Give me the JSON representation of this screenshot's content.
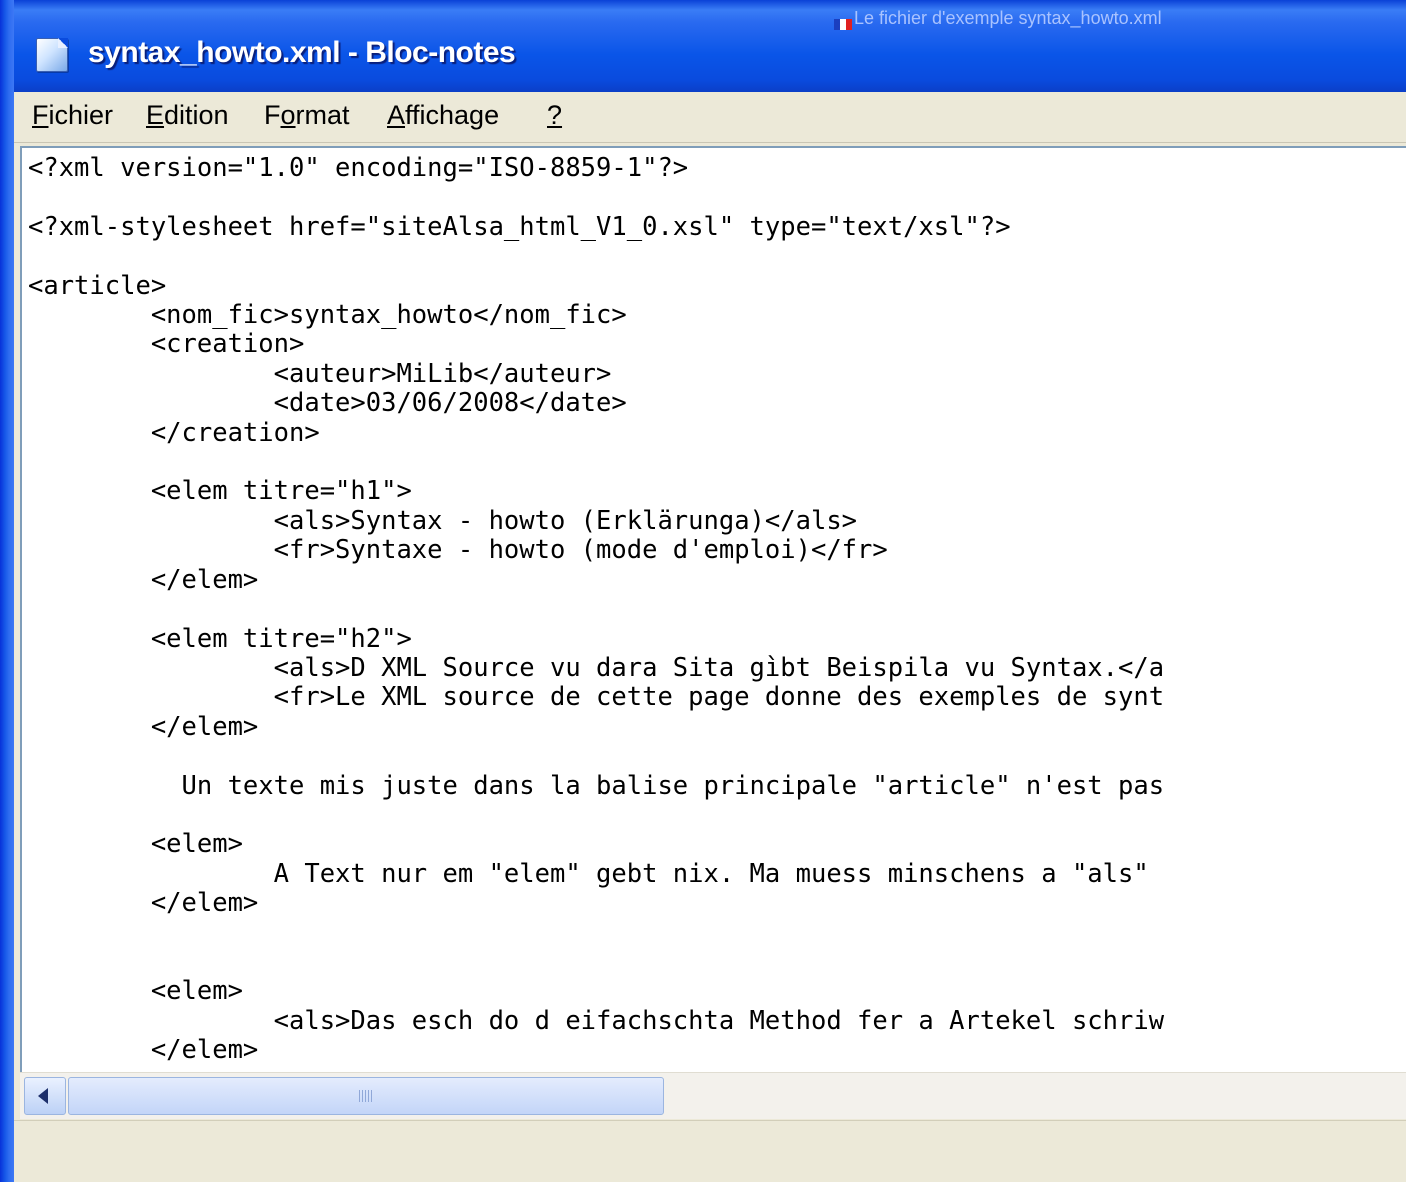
{
  "window": {
    "title": "syntax_howto.xml - Bloc-notes",
    "caption": "Le fichier d'exemple syntax_howto.xml"
  },
  "menu": {
    "file": {
      "pre": "",
      "key": "F",
      "post": "ichier"
    },
    "edit": {
      "pre": "",
      "key": "E",
      "post": "dition"
    },
    "format": {
      "pre": "F",
      "key": "o",
      "post": "rmat"
    },
    "view": {
      "pre": "",
      "key": "A",
      "post": "ffichage"
    },
    "help": {
      "pre": "",
      "key": "?",
      "post": ""
    }
  },
  "editor": {
    "content": "<?xml version=\"1.0\" encoding=\"ISO-8859-1\"?>\n\n<?xml-stylesheet href=\"siteAlsa_html_V1_0.xsl\" type=\"text/xsl\"?>\n\n<article>\n        <nom_fic>syntax_howto</nom_fic>\n        <creation>\n                <auteur>MiLib</auteur>\n                <date>03/06/2008</date>\n        </creation>\n\n        <elem titre=\"h1\">\n                <als>Syntax - howto (Erklärunga)</als>\n                <fr>Syntaxe - howto (mode d'emploi)</fr>\n        </elem>\n\n        <elem titre=\"h2\">\n                <als>D XML Source vu dara Sita gìbt Beispila vu Syntax.</a\n                <fr>Le XML source de cette page donne des exemples de synt\n        </elem>\n\n          Un texte mis juste dans la balise principale \"article\" n'est pas\n\n        <elem>\n                A Text nur em \"elem\" gebt nix. Ma muess minschens a \"als\"\n        </elem>\n\n\n        <elem>\n                <als>Das esch do d eifachschta Method fer a Artekel schriw\n        </elem>"
  },
  "colors": {
    "titlebar": "#0a4bde",
    "menubar": "#ece9d8",
    "editor_bg": "#ffffff",
    "caption_text": "#a9c3ff"
  }
}
